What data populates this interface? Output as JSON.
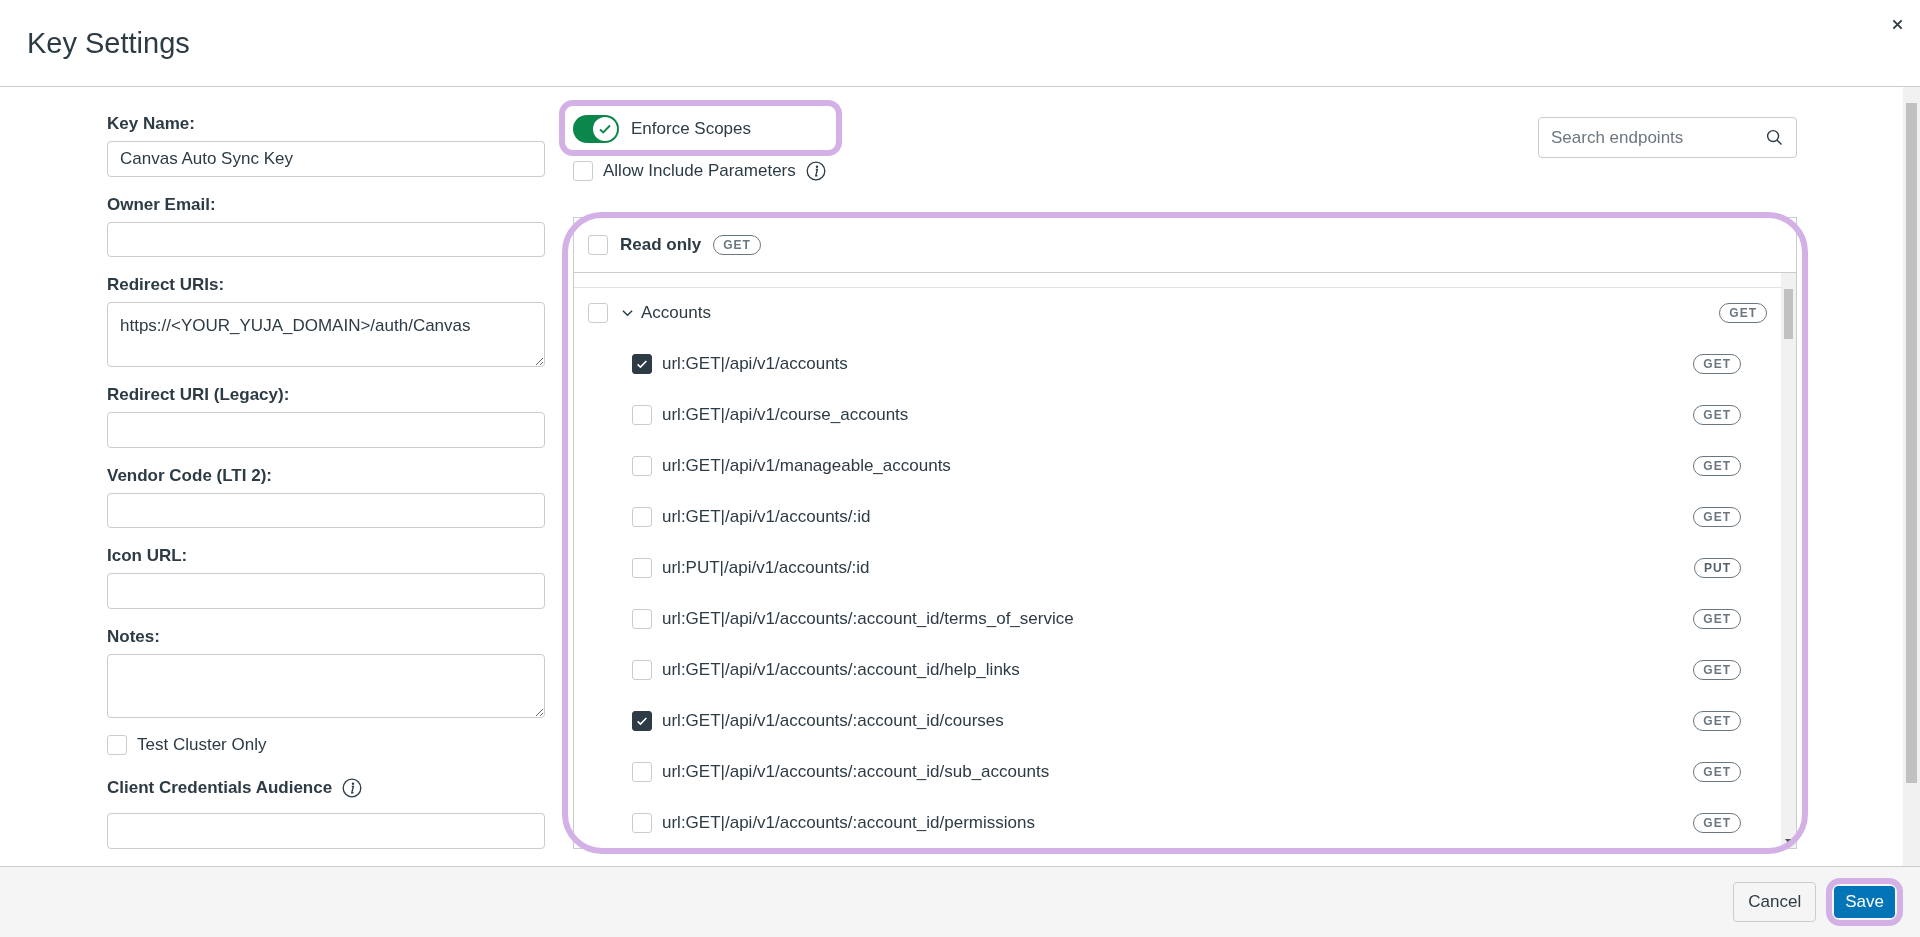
{
  "window": {
    "title": "Key Settings"
  },
  "form": {
    "fields": [
      {
        "label": "Key Name:",
        "kind": "input",
        "value": "Canvas Auto Sync Key"
      },
      {
        "label": "Owner Email:",
        "kind": "input"
      },
      {
        "label": "Redirect URIs:",
        "kind": "textarea",
        "value": "https://<YOUR_YUJA_DOMAIN>/auth/Canvas"
      },
      {
        "label": "Redirect URI (Legacy):",
        "kind": "input"
      },
      {
        "label": "Vendor Code (LTI 2):",
        "kind": "input"
      },
      {
        "label": "Icon URL:",
        "kind": "input"
      },
      {
        "label": "Notes:",
        "kind": "textarea"
      }
    ],
    "test_cluster_only": {
      "label": "Test Cluster Only",
      "checked": false
    },
    "audience": {
      "label": "Client Credentials Audience"
    }
  },
  "scopes": {
    "enforce_scopes": {
      "label": "Enforce Scopes",
      "on": true
    },
    "allow_include_parameters": {
      "label": "Allow Include Parameters",
      "checked": false
    },
    "search": {
      "placeholder": "Search endpoints"
    },
    "read_only": {
      "label": "Read only",
      "method": "GET",
      "checked": false
    },
    "groups": [
      {
        "name": "Accounts",
        "method": "GET",
        "checked": false,
        "expanded": true,
        "endpoints": [
          {
            "path": "url:GET|/api/v1/accounts",
            "method": "GET",
            "checked": true
          },
          {
            "path": "url:GET|/api/v1/course_accounts",
            "method": "GET",
            "checked": false
          },
          {
            "path": "url:GET|/api/v1/manageable_accounts",
            "method": "GET",
            "checked": false
          },
          {
            "path": "url:GET|/api/v1/accounts/:id",
            "method": "GET",
            "checked": false
          },
          {
            "path": "url:PUT|/api/v1/accounts/:id",
            "method": "PUT",
            "checked": false
          },
          {
            "path": "url:GET|/api/v1/accounts/:account_id/terms_of_service",
            "method": "GET",
            "checked": false
          },
          {
            "path": "url:GET|/api/v1/accounts/:account_id/help_links",
            "method": "GET",
            "checked": false
          },
          {
            "path": "url:GET|/api/v1/accounts/:account_id/courses",
            "method": "GET",
            "checked": true
          },
          {
            "path": "url:GET|/api/v1/accounts/:account_id/sub_accounts",
            "method": "GET",
            "checked": false
          },
          {
            "path": "url:GET|/api/v1/accounts/:account_id/permissions",
            "method": "GET",
            "checked": false
          }
        ]
      }
    ]
  },
  "buttons": [
    {
      "label": "Cancel",
      "kind": "secondary"
    },
    {
      "label": "Save",
      "kind": "primary"
    }
  ]
}
